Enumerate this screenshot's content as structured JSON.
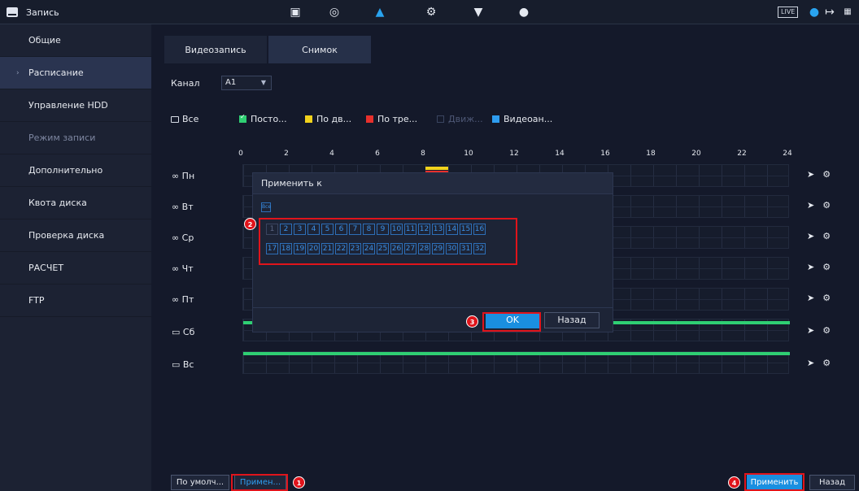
{
  "app": {
    "title": "Запись",
    "live_label": "LIVE"
  },
  "topbar_icons": [
    "camera-icon",
    "network-icon",
    "storage-icon",
    "settings-icon",
    "security-icon",
    "account-icon"
  ],
  "sidebar": {
    "items": [
      {
        "label": "Общие"
      },
      {
        "label": "Расписание",
        "active": true
      },
      {
        "label": "Управление HDD"
      },
      {
        "label": "Режим записи",
        "dim": true
      },
      {
        "label": "Дополнительно"
      },
      {
        "label": "Квота диска"
      },
      {
        "label": "Проверка диска"
      },
      {
        "label": "РАСЧЕТ"
      },
      {
        "label": "FTP"
      }
    ]
  },
  "tabs": [
    {
      "label": "Видеозапись"
    },
    {
      "label": "Снимок",
      "active": true
    }
  ],
  "channel": {
    "label": "Канал",
    "value": "A1"
  },
  "legend": {
    "all_label": "Все",
    "items": [
      {
        "label": "Посто...",
        "color": "#2fcf73"
      },
      {
        "label": "По дв...",
        "color": "#f2d21c"
      },
      {
        "label": "По тре...",
        "color": "#e8302c"
      },
      {
        "label": "Движ...",
        "color": "#3a4560",
        "dim": true
      },
      {
        "label": "Видеоан...",
        "color": "#2e9df0"
      }
    ]
  },
  "timeline": {
    "ticks": [
      "0",
      "2",
      "4",
      "6",
      "8",
      "10",
      "12",
      "14",
      "16",
      "18",
      "20",
      "22",
      "24"
    ]
  },
  "days": [
    {
      "label": "Пн"
    },
    {
      "label": "Вт"
    },
    {
      "label": "Ср"
    },
    {
      "label": "Чт"
    },
    {
      "label": "Пт"
    },
    {
      "label": "Сб"
    },
    {
      "label": "Вс"
    }
  ],
  "dialog": {
    "title": "Применить к",
    "all_label": "Все",
    "channels_row1": [
      "1",
      "2",
      "3",
      "4",
      "5",
      "6",
      "7",
      "8",
      "9",
      "10",
      "11",
      "12",
      "13",
      "14",
      "15",
      "16"
    ],
    "channels_row2": [
      "17",
      "18",
      "19",
      "20",
      "21",
      "22",
      "23",
      "24",
      "25",
      "26",
      "27",
      "28",
      "29",
      "30",
      "31",
      "32"
    ],
    "ok_label": "OK",
    "back_label": "Назад"
  },
  "footer": {
    "default_label": "По умолч...",
    "copy_label": "Примен...",
    "apply_label": "Применить",
    "back_label": "Назад"
  },
  "markers": [
    "1",
    "2",
    "3",
    "4"
  ]
}
